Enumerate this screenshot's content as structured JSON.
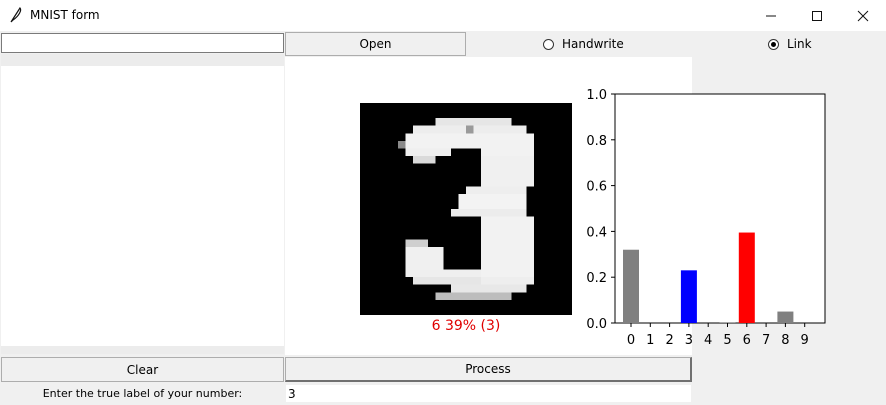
{
  "window": {
    "title": "MNIST form"
  },
  "top": {
    "path_value": "",
    "open_label": "Open",
    "radio_handwrite": "Handwrite",
    "radio_link": "Link",
    "selected_mode": "Link"
  },
  "prediction": {
    "text": "6 39% (3)",
    "color": "#e00000"
  },
  "bottom": {
    "clear_label": "Clear",
    "process_label": "Process",
    "true_label_prompt": "Enter the true label of your number:",
    "true_label_value": "3"
  },
  "chart_data": {
    "type": "bar",
    "categories": [
      "0",
      "1",
      "2",
      "3",
      "4",
      "5",
      "6",
      "7",
      "8",
      "9"
    ],
    "values": [
      0.32,
      0.0,
      0.0,
      0.23,
      0.0,
      0.003,
      0.395,
      0.0,
      0.05,
      0.0
    ],
    "colors": [
      "#808080",
      "#808080",
      "#808080",
      "#0000ff",
      "#808080",
      "#808080",
      "#ff0000",
      "#808080",
      "#808080",
      "#808080"
    ],
    "ylim": [
      0,
      1.0
    ],
    "yticks": [
      "0.0",
      "0.2",
      "0.4",
      "0.6",
      "0.8",
      "1.0"
    ],
    "title": "",
    "xlabel": "",
    "ylabel": ""
  }
}
